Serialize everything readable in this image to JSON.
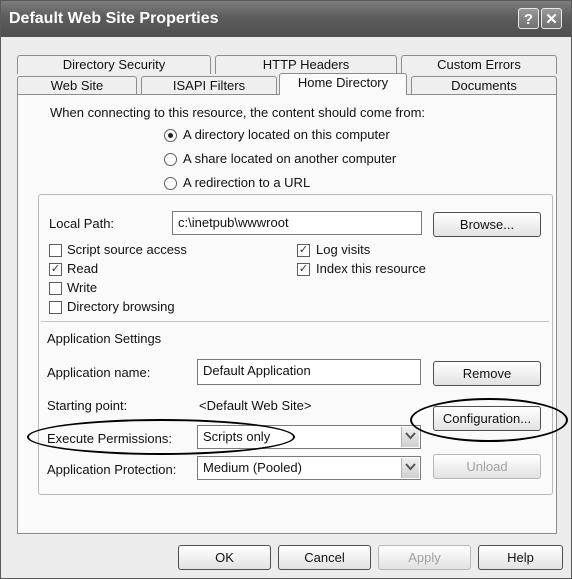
{
  "window": {
    "title": "Default Web Site Properties",
    "help_glyph": "?",
    "close_glyph": "✕"
  },
  "tabs": {
    "row1": [
      "Directory Security",
      "HTTP Headers",
      "Custom Errors"
    ],
    "row2": [
      "Web Site",
      "ISAPI Filters",
      "Home Directory",
      "Documents"
    ],
    "active": "Home Directory"
  },
  "source": {
    "prompt": "When connecting to this resource, the content should come from:",
    "options": [
      "A directory located on this computer",
      "A share located on another computer",
      "A redirection to a URL"
    ],
    "selected": "A directory located on this computer"
  },
  "path": {
    "label": "Local Path:",
    "value": "c:\\inetpub\\wwwroot",
    "browse_label": "Browse..."
  },
  "permissions": {
    "left": [
      {
        "label": "Script source access",
        "checked": false
      },
      {
        "label": "Read",
        "checked": true
      },
      {
        "label": "Write",
        "checked": false
      },
      {
        "label": "Directory browsing",
        "checked": false
      }
    ],
    "right": [
      {
        "label": "Log visits",
        "checked": true
      },
      {
        "label": "Index this resource",
        "checked": true
      }
    ]
  },
  "app": {
    "section_label": "Application Settings",
    "name_label": "Application name:",
    "name_value": "Default Application",
    "remove_label": "Remove",
    "start_label": "Starting point:",
    "start_value": "<Default Web Site>",
    "config_label": "Configuration...",
    "exec_label": "Execute Permissions:",
    "exec_value": "Scripts only",
    "protect_label": "Application Protection:",
    "protect_value": "Medium (Pooled)",
    "unload_label": "Unload"
  },
  "footer": {
    "ok": "OK",
    "cancel": "Cancel",
    "apply": "Apply",
    "help": "Help"
  }
}
